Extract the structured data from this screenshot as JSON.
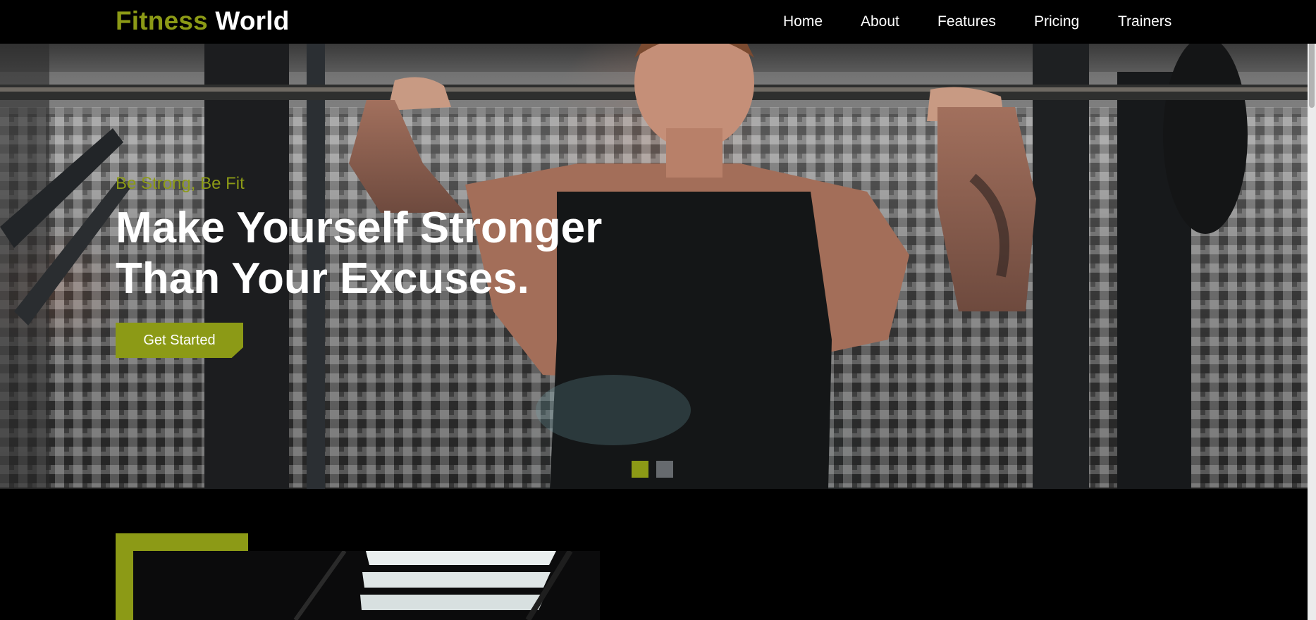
{
  "brand": {
    "name_accent": "Fitness",
    "name_rest": "World"
  },
  "nav": {
    "links": [
      "Home",
      "About",
      "Features",
      "Pricing",
      "Trainers"
    ]
  },
  "hero": {
    "tagline": "Be Strong, Be Fit",
    "title_line1": "Make Yourself Stronger",
    "title_line2": "Than Your Excuses.",
    "cta_label": "Get Started",
    "slide_count": 2,
    "active_slide": 1
  },
  "colors": {
    "accent": "#8c9a16",
    "background": "#000000",
    "text": "#ffffff",
    "inactive_dot": "#666a6e"
  }
}
